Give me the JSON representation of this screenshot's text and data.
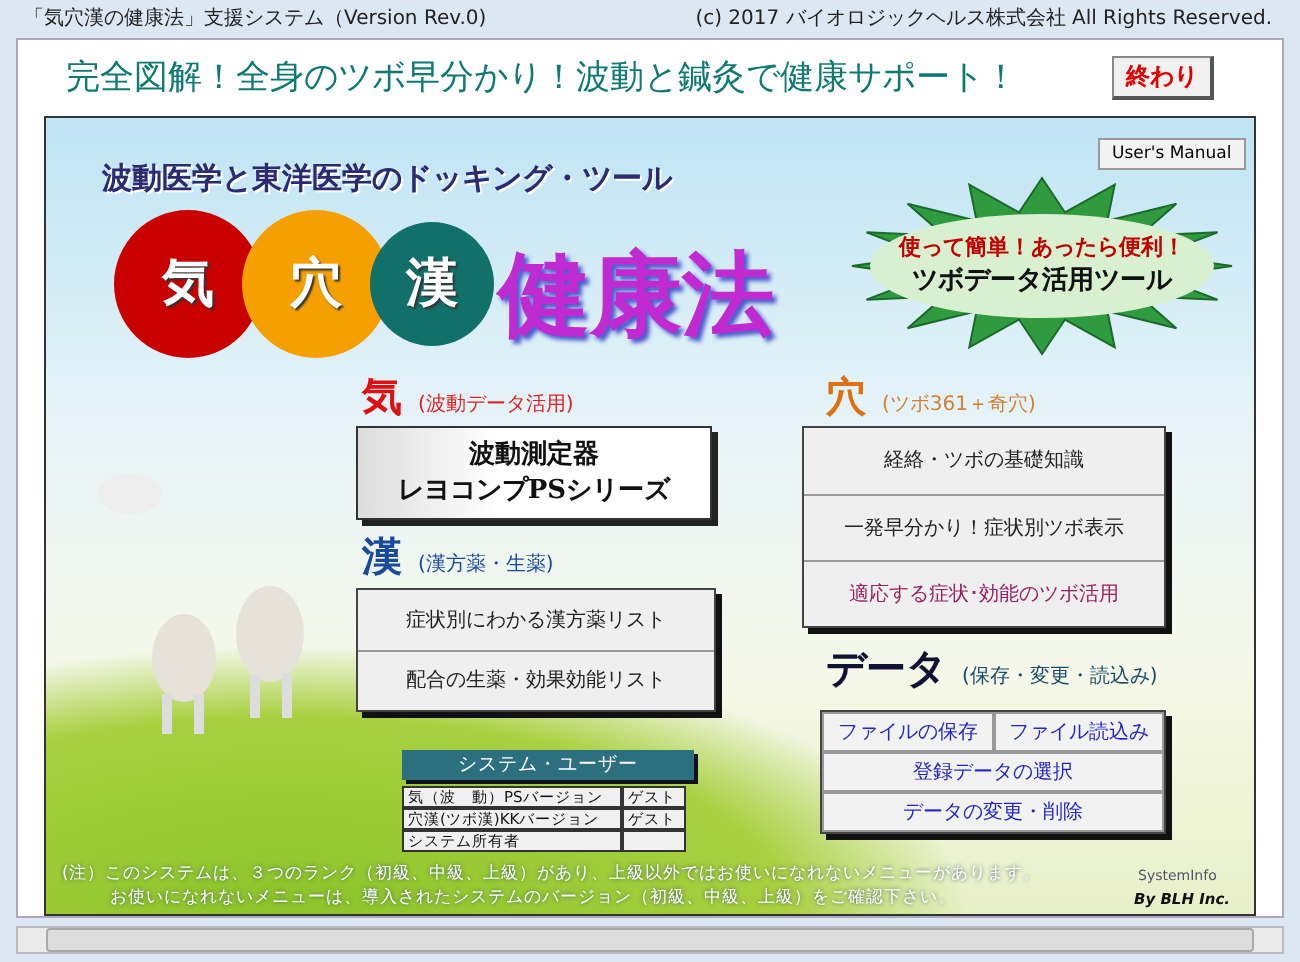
{
  "window": {
    "title": "「気穴漢の健康法」支援システム（Version Rev.0)",
    "copyright": "(c) 2017 バイオロジックヘルス株式会社 All Rights Reserved."
  },
  "headline": "完全図解！全身のツボ早分かり！波動と鍼灸で健康サポート！",
  "exit_button": "終わり",
  "manual_button": "User's Manual",
  "subtitle": "波動医学と東洋医学のドッキング・ツール",
  "logo_circles": [
    {
      "label": "気",
      "color": "#c80000"
    },
    {
      "label": "穴",
      "color": "#f5a000"
    },
    {
      "label": "漢",
      "color": "#11706a"
    }
  ],
  "logo_name": "健康法",
  "badge": {
    "line1": "使って簡単！あったら便利！",
    "line2": "ツボデータ活用ツール"
  },
  "ki": {
    "heading": "気",
    "note": "(波動データ活用)",
    "device_button": {
      "line1": "波動測定器",
      "line2": "レヨコンプPSシリーズ"
    }
  },
  "kan": {
    "heading": "漢",
    "note": "(漢方薬・生薬)",
    "buttons": [
      "症状別にわかる漢方薬リスト",
      "配合の生薬・効果効能リスト"
    ]
  },
  "ketsu": {
    "heading": "穴",
    "note": "(ツボ361＋奇穴)",
    "buttons": [
      {
        "label": "経絡・ツボの基礎知識",
        "kind": "normal"
      },
      {
        "label": "一発早分かり！症状別ツボ表示",
        "kind": "normal"
      },
      {
        "label": "適応する症状･効能のツボ活用",
        "kind": "accent"
      }
    ]
  },
  "data": {
    "heading": "データ",
    "note": "(保存・変更・読込み)",
    "rows": [
      [
        "ファイルの保存",
        "ファイル読込み"
      ],
      [
        "登録データの選択"
      ],
      [
        "データの変更・削除"
      ]
    ]
  },
  "user_table": {
    "title": "システム・ユーザー",
    "rows": [
      {
        "label": "気（波　動）PSバージョン",
        "value": "ゲスト"
      },
      {
        "label": "穴漢(ツボ漢)KKバージョン",
        "value": "ゲスト"
      },
      {
        "label": "システム所有者"
      }
    ]
  },
  "notes": [
    "(注）このシステムは、３つのランク（初級、中級、上級）があり、上級以外ではお使いになれないメニューがあります。",
    "お使いになれないメニューは、導入されたシステムのバージョン（初級、中級、上級）をご確認下さい。"
  ],
  "system_info": "SystemInfo",
  "credit": "By BLH Inc."
}
